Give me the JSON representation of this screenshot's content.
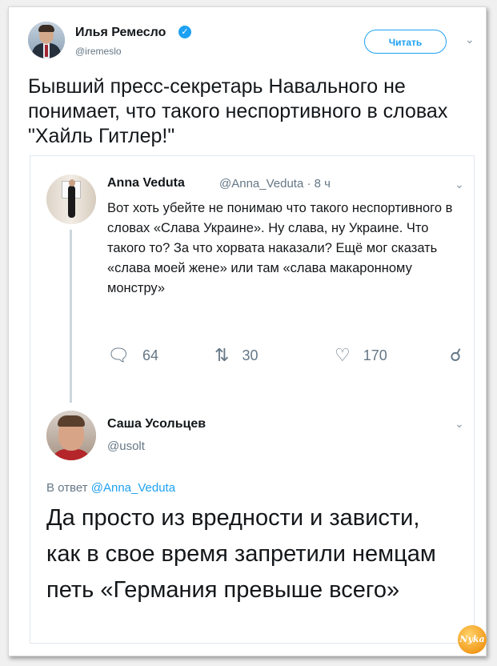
{
  "main_tweet": {
    "author_name": "Илья Ремесло",
    "author_handle": "@iremeslo",
    "follow_label": "Читать",
    "text": "Бывший пресс-секретарь Навального не понимает, что такого неспортивного в словах \"Хайль Гитлер!\""
  },
  "quoted_tweet": {
    "author_name": "Anna Veduta",
    "meta": "@Anna_Veduta · 8 ч",
    "text": "Вот хоть убейте не понимаю что такого неспортивного в словах «Слава Украине». Ну слава, ну Украине. Что такого то? За что хорвата наказали? Ещё мог сказать «слава моей жене» или там «слава макаронному монстру»",
    "replies": "64",
    "retweets": "30",
    "likes": "170"
  },
  "reply_tweet": {
    "author_name": "Саша Усольцев",
    "author_handle": "@usolt",
    "reply_prefix": "В ответ",
    "reply_to": "@Anna_Veduta",
    "text": "Да просто из вредности и зависти, как в свое время запретили немцам петь «Германия превыше всего»"
  },
  "icons": {
    "verified": "verified-badge-icon",
    "reply": "reply-icon",
    "retweet": "retweet-icon",
    "like": "heart-icon",
    "share": "share-icon",
    "chevron": "chevron-down-icon"
  },
  "colors": {
    "accent": "#1da1f2",
    "muted": "#657786",
    "text": "#14171a"
  }
}
